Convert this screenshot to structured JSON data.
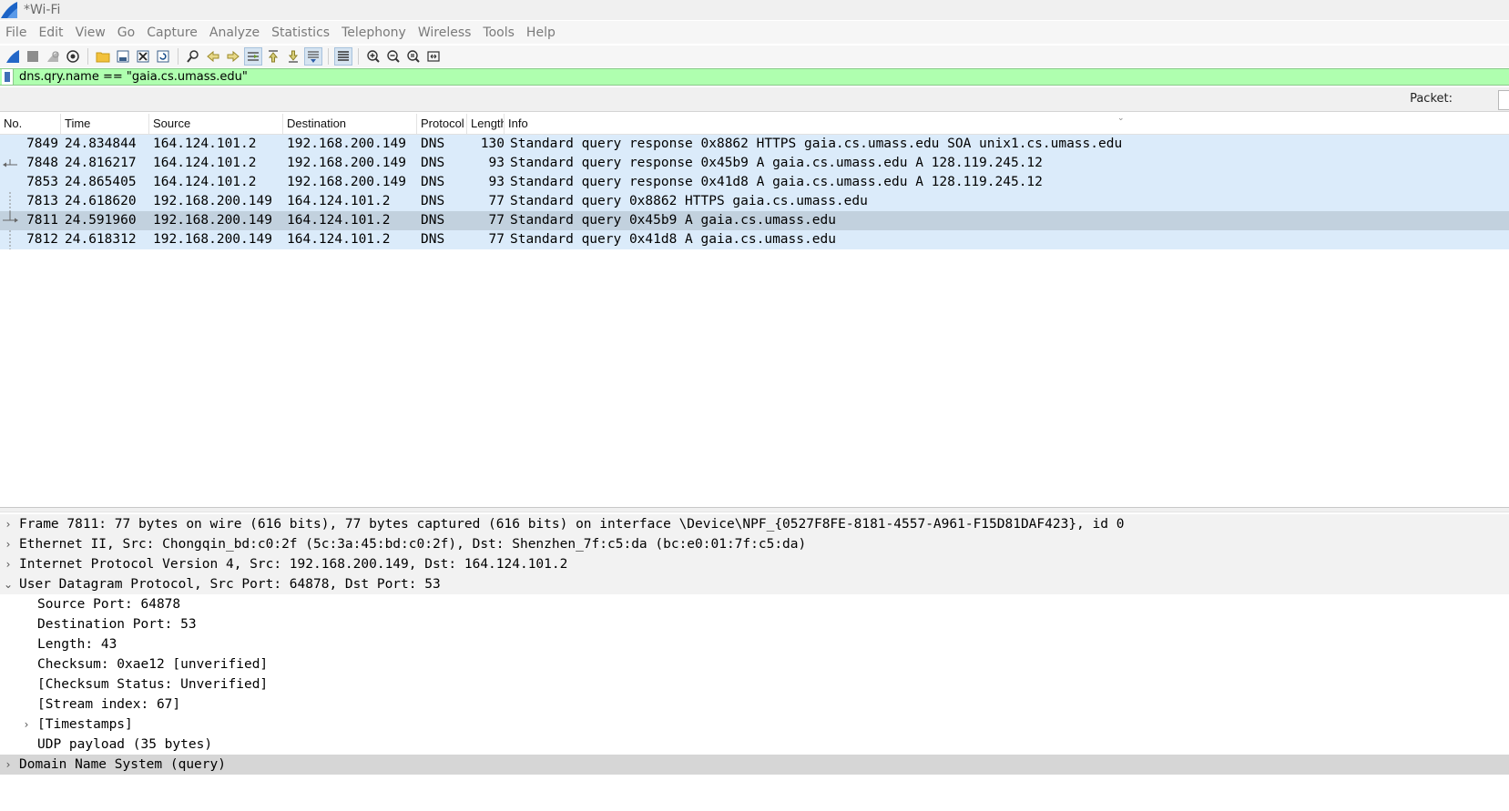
{
  "window": {
    "title": "*Wi-Fi"
  },
  "menu": [
    "File",
    "Edit",
    "View",
    "Go",
    "Capture",
    "Analyze",
    "Statistics",
    "Telephony",
    "Wireless",
    "Tools",
    "Help"
  ],
  "toolbar": {
    "icons": [
      "shark-fin-start-icon",
      "stop-icon",
      "restart-icon",
      "capture-options-icon",
      "open-folder-icon",
      "save-file-icon",
      "close-file-icon",
      "reload-icon",
      "find-packet-icon",
      "go-back-icon",
      "go-forward-icon",
      "go-to-packet-icon",
      "first-packet-icon",
      "last-packet-icon",
      "autoscroll-icon",
      "colorize-icon",
      "zoom-in-icon",
      "zoom-out-icon",
      "zoom-normal-icon",
      "resize-columns-icon"
    ]
  },
  "filter": {
    "value": "dns.qry.name == \"gaia.cs.umass.edu\""
  },
  "packet_bar": {
    "label": "Packet:"
  },
  "packet_list": {
    "columns": [
      "No.",
      "Time",
      "Source",
      "Destination",
      "Protocol",
      "Length",
      "Info"
    ],
    "rows": [
      {
        "no": "7849",
        "time": "24.834844",
        "src": "164.124.101.2",
        "dst": "192.168.200.149",
        "proto": "DNS",
        "len": "130",
        "info": "Standard query response 0x8862 HTTPS gaia.cs.umass.edu SOA unix1.cs.umass.edu"
      },
      {
        "no": "7848",
        "time": "24.816217",
        "src": "164.124.101.2",
        "dst": "192.168.200.149",
        "proto": "DNS",
        "len": "93",
        "info": "Standard query response 0x45b9 A gaia.cs.umass.edu A 128.119.245.12"
      },
      {
        "no": "7853",
        "time": "24.865405",
        "src": "164.124.101.2",
        "dst": "192.168.200.149",
        "proto": "DNS",
        "len": "93",
        "info": "Standard query response 0x41d8 A gaia.cs.umass.edu A 128.119.245.12"
      },
      {
        "no": "7813",
        "time": "24.618620",
        "src": "192.168.200.149",
        "dst": "164.124.101.2",
        "proto": "DNS",
        "len": "77",
        "info": "Standard query 0x8862 HTTPS gaia.cs.umass.edu"
      },
      {
        "no": "7811",
        "time": "24.591960",
        "src": "192.168.200.149",
        "dst": "164.124.101.2",
        "proto": "DNS",
        "len": "77",
        "info": "Standard query 0x45b9 A gaia.cs.umass.edu"
      },
      {
        "no": "7812",
        "time": "24.618312",
        "src": "192.168.200.149",
        "dst": "164.124.101.2",
        "proto": "DNS",
        "len": "77",
        "info": "Standard query 0x41d8 A gaia.cs.umass.edu"
      }
    ]
  },
  "details": {
    "frame": "Frame 7811: 77 bytes on wire (616 bits), 77 bytes captured (616 bits) on interface \\Device\\NPF_{0527F8FE-8181-4557-A961-F15D81DAF423}, id 0",
    "ethernet": "Ethernet II, Src: Chongqin_bd:c0:2f (5c:3a:45:bd:c0:2f), Dst: Shenzhen_7f:c5:da (bc:e0:01:7f:c5:da)",
    "ip": "Internet Protocol Version 4, Src: 192.168.200.149, Dst: 164.124.101.2",
    "udp": "User Datagram Protocol, Src Port: 64878, Dst Port: 53",
    "udp_fields": {
      "src_port": "Source Port: 64878",
      "dst_port": "Destination Port: 53",
      "length": "Length: 43",
      "checksum": "Checksum: 0xae12 [unverified]",
      "checksum_status": "[Checksum Status: Unverified]",
      "stream_index": "[Stream index: 67]",
      "timestamps": "[Timestamps]",
      "payload": "UDP payload (35 bytes)"
    },
    "dns": "Domain Name System (query)"
  },
  "colors": {
    "filter_ok": "#afffaf",
    "row_bg": "#dbebfa",
    "row_selected": "#c2d1de",
    "detail_selected": "#d6d6d6"
  }
}
